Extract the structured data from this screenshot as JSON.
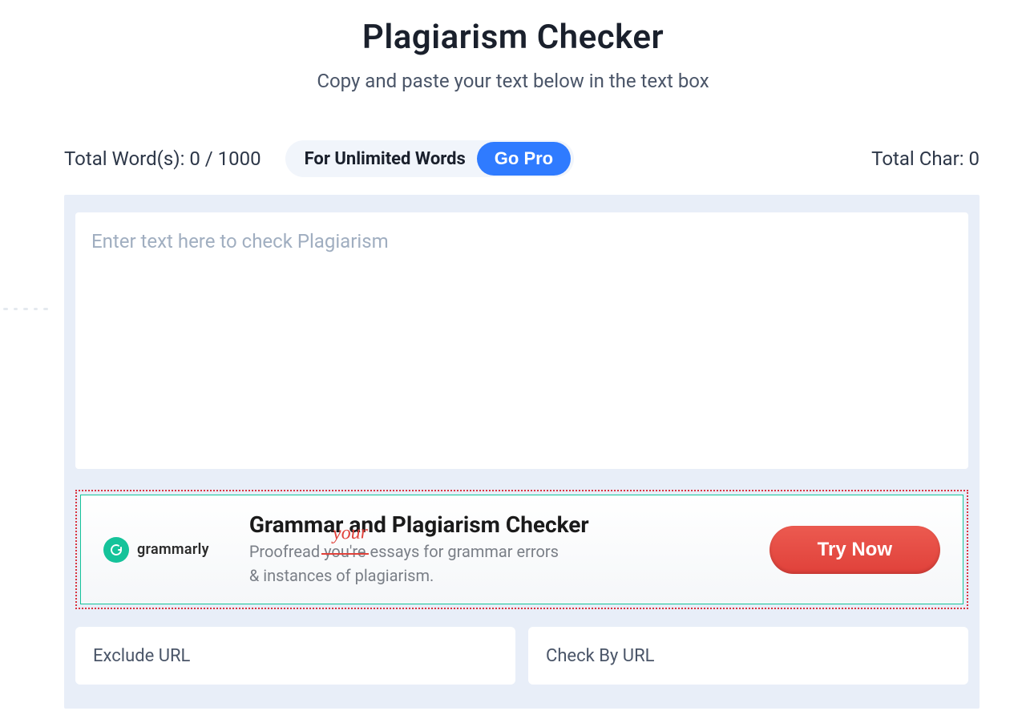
{
  "header": {
    "title": "Plagiarism Checker",
    "subtitle": "Copy and paste your text below in the text box"
  },
  "stats": {
    "word_label": "Total Word(s): 0 / 1000",
    "char_label": "Total Char: 0"
  },
  "pro": {
    "text": "For Unlimited Words",
    "button": "Go Pro"
  },
  "editor": {
    "placeholder": "Enter text here to check Plagiarism"
  },
  "ad": {
    "brand": "grammarly",
    "title": "Grammar and Plagiarism Checker",
    "line1_prefix": "Proofread ",
    "line1_strike": "you're",
    "line1_suffix": " essays for grammar errors",
    "line2": "& instances of plagiarism.",
    "handwritten": "your",
    "cta": "Try Now"
  },
  "urls": {
    "exclude_placeholder": "Exclude URL",
    "check_placeholder": "Check By URL"
  }
}
